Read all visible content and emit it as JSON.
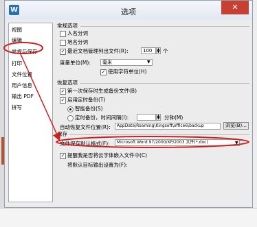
{
  "window": {
    "title": "选项",
    "close_label": "✕",
    "app_icon": "W"
  },
  "sidebar": {
    "items": [
      {
        "label": "视图"
      },
      {
        "label": "编辑"
      },
      {
        "label": "常规与保存"
      },
      {
        "label": "打印"
      },
      {
        "label": "文件位置"
      },
      {
        "label": "用户信息"
      },
      {
        "label": "输出 PDF"
      },
      {
        "label": "拼写"
      }
    ]
  },
  "general": {
    "group_title": "常规选项",
    "person_name_tagging": "人名分词",
    "place_name_tagging": "地名分词",
    "recent_files_label": "最近文档管理列出文件(R):",
    "recent_files_value": "100",
    "recent_files_unit": "个",
    "measure_unit_label": "度量单位(M):",
    "measure_unit_value": "毫米",
    "use_char_unit": "使用字符单位(H)"
  },
  "recovery": {
    "group_title": "恢复选项",
    "first_save_backup": "第一次保存时生成备份文件(B)",
    "enable_timed_backup": "启用定时备份(T)",
    "smart_backup": "智能备份(S)",
    "timed_backup_label": "定时备份，时间间隔(I):",
    "timed_unit": "分钟(M)",
    "auto_location_label": "自动恢复文件位置(R):",
    "auto_location_value": "AppData\\Roaming\\Kingsoft\\office6\\backup",
    "browse_label": "浏览(B)..."
  },
  "save": {
    "group_title": "保存",
    "default_format_label": "文件保存默认格式(F):",
    "default_format_value": "Microsoft Word 97/2000/XP/2003 文件(*.doc)",
    "embed_fonts_prompt": "提醒我是否将云字体嵌入文件中(C)",
    "default_target_label": "将默认目标输出设置为(F):"
  },
  "annotation": {
    "color": "#d11d1d"
  }
}
